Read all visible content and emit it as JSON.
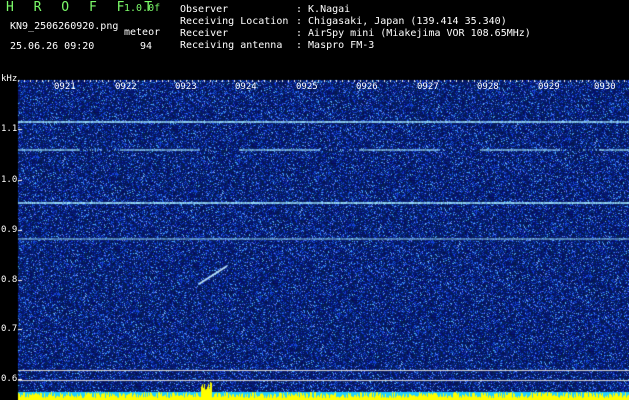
{
  "header": {
    "title": "H R O F F T",
    "version": "1.0.0f",
    "filename": "KN9_2506260920.png",
    "mode": "meteor",
    "datetime": "25.06.26 09:20",
    "count": "94",
    "fields": [
      {
        "label": "Observer",
        "value": ": K.Nagai"
      },
      {
        "label": "Receiving Location",
        "value": ": Chigasaki, Japan (139.414 35.340)"
      },
      {
        "label": "Receiver",
        "value": ": AirSpy mini (Miakejima VOR 108.65MHz)"
      },
      {
        "label": "Receiving antenna",
        "value": ": Maspro FM-3"
      }
    ]
  },
  "spectrogram": {
    "y_unit": "kHz",
    "y_ticks": [
      "1.1",
      "1.0",
      "0.9",
      "0.8",
      "0.7",
      "0.6"
    ],
    "time_ticks": [
      "0921",
      "0922",
      "0923",
      "0924",
      "0925",
      "0926",
      "0927",
      "0928",
      "0929",
      "0930"
    ],
    "colors": {
      "background": "#000000",
      "noise_dark": "#050a5a",
      "noise_light": "#3c6cff",
      "carrier": "#9fe6ff",
      "bottom_yellow": "#ffff00",
      "bottom_cyan": "#22d0ff",
      "ref_line": "#d8d8d8"
    }
  }
}
